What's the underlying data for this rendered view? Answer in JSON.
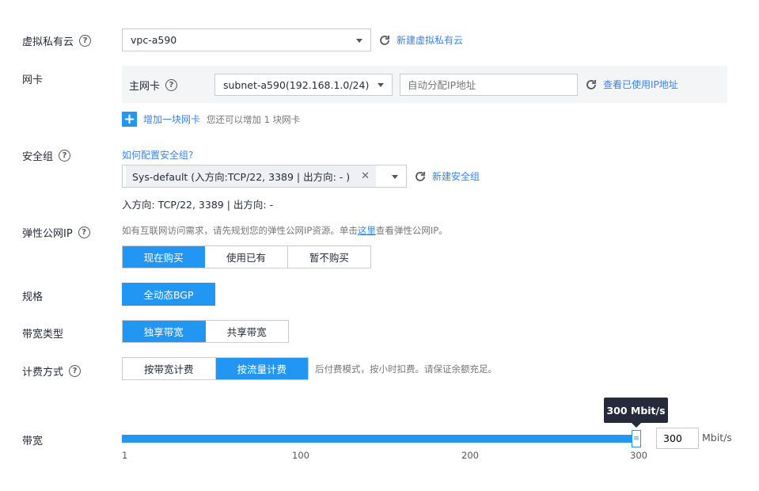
{
  "vpc": {
    "label": "虚拟私有云",
    "value": "vpc-a590",
    "create_link": "新建虚拟私有云"
  },
  "nic": {
    "label": "网卡",
    "primary_label": "主网卡",
    "subnet_value": "subnet-a590(192.168.1.0/24)",
    "ip_placeholder": "自动分配IP地址",
    "view_used_ip_link": "查看已使用IP地址",
    "add_link": "增加一块网卡",
    "add_hint": "您还可以增加 1 块网卡"
  },
  "security_group": {
    "label": "安全组",
    "howto_link": "如何配置安全组?",
    "tag_value": "Sys-default (入方向:TCP/22, 3389 | 出方向: - )",
    "create_link": "新建安全组",
    "summary": "入方向: TCP/22, 3389 | 出方向: -"
  },
  "eip": {
    "label": "弹性公网IP",
    "hint_before": "如有互联网访问需求，请先规划您的弹性公网IP资源。单击",
    "hint_link": "这里",
    "hint_after": "查看弹性公网IP。",
    "options": [
      "现在购买",
      "使用已有",
      "暂不购买"
    ],
    "selected": 0
  },
  "spec": {
    "label": "规格",
    "options": [
      "全动态BGP"
    ],
    "selected": 0
  },
  "bandwidth_type": {
    "label": "带宽类型",
    "options": [
      "独享带宽",
      "共享带宽"
    ],
    "selected": 0
  },
  "billing": {
    "label": "计费方式",
    "options": [
      "按带宽计费",
      "按流量计费"
    ],
    "selected": 1,
    "hint": "后付费模式，按小时扣费。请保证余额充足。"
  },
  "bandwidth": {
    "label": "带宽",
    "tooltip": "300 Mbit/s",
    "value": "300",
    "unit": "Mbit/s",
    "ticks": [
      "1",
      "100",
      "200",
      "300"
    ],
    "min": 1,
    "max": 300,
    "current": 300
  },
  "colors": {
    "accent": "#2196f3",
    "link": "#3a84e6",
    "panel": "#f4f5f7"
  }
}
